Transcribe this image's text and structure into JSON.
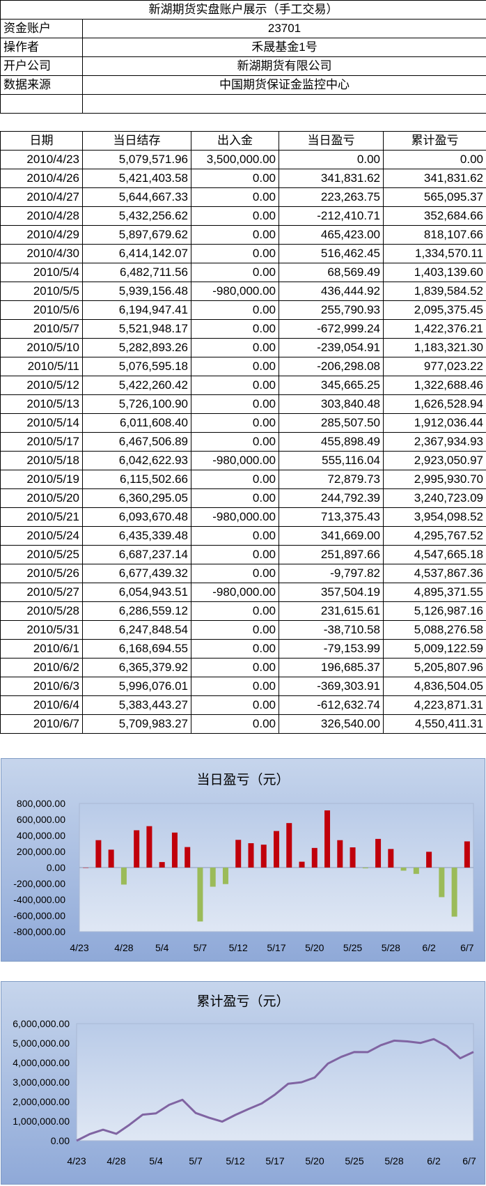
{
  "title": "新湖期货实盘账户展示（手工交易）",
  "info": [
    {
      "label": "资金账户",
      "value": "23701"
    },
    {
      "label": "操作者",
      "value": "禾晟基金1号"
    },
    {
      "label": "开户公司",
      "value": "新湖期货有限公司"
    },
    {
      "label": "数据来源",
      "value": "中国期货保证金监控中心"
    }
  ],
  "table": {
    "headers": [
      "日期",
      "当日结存",
      "出入金",
      "当日盈亏",
      "累计盈亏"
    ],
    "rows": [
      [
        "2010/4/23",
        "5,079,571.96",
        "3,500,000.00",
        "0.00",
        "0.00"
      ],
      [
        "2010/4/26",
        "5,421,403.58",
        "0.00",
        "341,831.62",
        "341,831.62"
      ],
      [
        "2010/4/27",
        "5,644,667.33",
        "0.00",
        "223,263.75",
        "565,095.37"
      ],
      [
        "2010/4/28",
        "5,432,256.62",
        "0.00",
        "-212,410.71",
        "352,684.66"
      ],
      [
        "2010/4/29",
        "5,897,679.62",
        "0.00",
        "465,423.00",
        "818,107.66"
      ],
      [
        "2010/4/30",
        "6,414,142.07",
        "0.00",
        "516,462.45",
        "1,334,570.11"
      ],
      [
        "2010/5/4",
        "6,482,711.56",
        "0.00",
        "68,569.49",
        "1,403,139.60"
      ],
      [
        "2010/5/5",
        "5,939,156.48",
        "-980,000.00",
        "436,444.92",
        "1,839,584.52"
      ],
      [
        "2010/5/6",
        "6,194,947.41",
        "0.00",
        "255,790.93",
        "2,095,375.45"
      ],
      [
        "2010/5/7",
        "5,521,948.17",
        "0.00",
        "-672,999.24",
        "1,422,376.21"
      ],
      [
        "2010/5/10",
        "5,282,893.26",
        "0.00",
        "-239,054.91",
        "1,183,321.30"
      ],
      [
        "2010/5/11",
        "5,076,595.18",
        "0.00",
        "-206,298.08",
        "977,023.22"
      ],
      [
        "2010/5/12",
        "5,422,260.42",
        "0.00",
        "345,665.25",
        "1,322,688.46"
      ],
      [
        "2010/5/13",
        "5,726,100.90",
        "0.00",
        "303,840.48",
        "1,626,528.94"
      ],
      [
        "2010/5/14",
        "6,011,608.40",
        "0.00",
        "285,507.50",
        "1,912,036.44"
      ],
      [
        "2010/5/17",
        "6,467,506.89",
        "0.00",
        "455,898.49",
        "2,367,934.93"
      ],
      [
        "2010/5/18",
        "6,042,622.93",
        "-980,000.00",
        "555,116.04",
        "2,923,050.97"
      ],
      [
        "2010/5/19",
        "6,115,502.66",
        "0.00",
        "72,879.73",
        "2,995,930.70"
      ],
      [
        "2010/5/20",
        "6,360,295.05",
        "0.00",
        "244,792.39",
        "3,240,723.09"
      ],
      [
        "2010/5/21",
        "6,093,670.48",
        "-980,000.00",
        "713,375.43",
        "3,954,098.52"
      ],
      [
        "2010/5/24",
        "6,435,339.48",
        "0.00",
        "341,669.00",
        "4,295,767.52"
      ],
      [
        "2010/5/25",
        "6,687,237.14",
        "0.00",
        "251,897.66",
        "4,547,665.18"
      ],
      [
        "2010/5/26",
        "6,677,439.32",
        "0.00",
        "-9,797.82",
        "4,537,867.36"
      ],
      [
        "2010/5/27",
        "6,054,943.51",
        "-980,000.00",
        "357,504.19",
        "4,895,371.55"
      ],
      [
        "2010/5/28",
        "6,286,559.12",
        "0.00",
        "231,615.61",
        "5,126,987.16"
      ],
      [
        "2010/5/31",
        "6,247,848.54",
        "0.00",
        "-38,710.58",
        "5,088,276.58"
      ],
      [
        "2010/6/1",
        "6,168,694.55",
        "0.00",
        "-79,153.99",
        "5,009,122.59"
      ],
      [
        "2010/6/2",
        "6,365,379.92",
        "0.00",
        "196,685.37",
        "5,205,807.96"
      ],
      [
        "2010/6/3",
        "5,996,076.01",
        "0.00",
        "-369,303.91",
        "4,836,504.05"
      ],
      [
        "2010/6/4",
        "5,383,443.27",
        "0.00",
        "-612,632.74",
        "4,223,871.31"
      ],
      [
        "2010/6/7",
        "5,709,983.27",
        "0.00",
        "326,540.00",
        "4,550,411.31"
      ]
    ]
  },
  "chart_data": [
    {
      "type": "bar",
      "title": "当日盈亏（元）",
      "categories": [
        "4/23",
        "4/26",
        "4/27",
        "4/28",
        "4/29",
        "4/30",
        "5/4",
        "5/5",
        "5/6",
        "5/7",
        "5/10",
        "5/11",
        "5/12",
        "5/13",
        "5/14",
        "5/17",
        "5/18",
        "5/19",
        "5/20",
        "5/21",
        "5/24",
        "5/25",
        "5/26",
        "5/27",
        "5/28",
        "5/31",
        "6/1",
        "6/2",
        "6/3",
        "6/4",
        "6/7"
      ],
      "values": [
        0,
        341831.62,
        223263.75,
        -212410.71,
        465423.0,
        516462.45,
        68569.49,
        436444.92,
        255790.93,
        -672999.24,
        -239054.91,
        -206298.08,
        345665.25,
        303840.48,
        285507.5,
        455898.49,
        555116.04,
        72879.73,
        244792.39,
        713375.43,
        341669.0,
        251897.66,
        -9797.82,
        357504.19,
        231615.61,
        -38710.58,
        -79153.99,
        196685.37,
        -369303.91,
        -612632.74,
        326540.0
      ],
      "ylim": [
        -800000,
        800000
      ],
      "yticks": [
        "800,000.00",
        "600,000.00",
        "400,000.00",
        "200,000.00",
        "0.00",
        "-200,000.00",
        "-400,000.00",
        "-600,000.00",
        "-800,000.00"
      ],
      "xticks": [
        "4/23",
        "4/28",
        "5/4",
        "5/7",
        "5/12",
        "5/17",
        "5/20",
        "5/25",
        "5/28",
        "6/2",
        "6/7"
      ],
      "colors": {
        "positive": "#c0000b",
        "negative": "#9bbb59",
        "bg_top": "#c6d5ec",
        "bg_bottom": "#8fa9d8"
      },
      "grid": false
    },
    {
      "type": "line",
      "title": "累计盈亏（元）",
      "categories": [
        "4/23",
        "4/26",
        "4/27",
        "4/28",
        "4/29",
        "4/30",
        "5/4",
        "5/5",
        "5/6",
        "5/7",
        "5/10",
        "5/11",
        "5/12",
        "5/13",
        "5/14",
        "5/17",
        "5/18",
        "5/19",
        "5/20",
        "5/21",
        "5/24",
        "5/25",
        "5/26",
        "5/27",
        "5/28",
        "5/31",
        "6/1",
        "6/2",
        "6/3",
        "6/4",
        "6/7"
      ],
      "values": [
        0,
        341831.62,
        565095.37,
        352684.66,
        818107.66,
        1334570.11,
        1403139.6,
        1839584.52,
        2095375.45,
        1422376.21,
        1183321.3,
        977023.22,
        1322688.46,
        1626528.94,
        1912036.44,
        2367934.93,
        2923050.97,
        2995930.7,
        3240723.09,
        3954098.52,
        4295767.52,
        4547665.18,
        4537867.36,
        4895371.55,
        5126987.16,
        5088276.58,
        5009122.59,
        5205807.96,
        4836504.05,
        4223871.31,
        4550411.31
      ],
      "ylim": [
        0,
        6000000
      ],
      "yticks": [
        "6,000,000.00",
        "5,000,000.00",
        "4,000,000.00",
        "3,000,000.00",
        "2,000,000.00",
        "1,000,000.00",
        "0.00"
      ],
      "xticks": [
        "4/23",
        "4/28",
        "5/4",
        "5/7",
        "5/12",
        "5/17",
        "5/20",
        "5/25",
        "5/28",
        "6/2",
        "6/7"
      ],
      "colors": {
        "line": "#8064a2",
        "bg_top": "#c6d5ec",
        "bg_bottom": "#8fa9d8"
      },
      "grid": false
    }
  ]
}
